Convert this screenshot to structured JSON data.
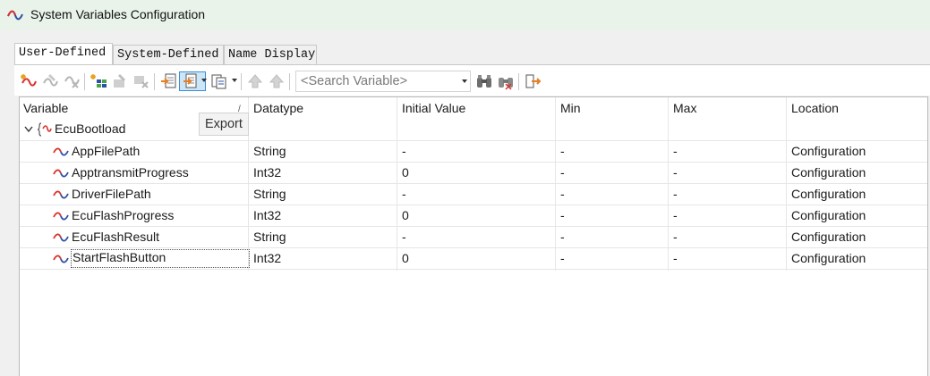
{
  "window": {
    "title": "System Variables Configuration",
    "icon": "system-variable-icon"
  },
  "tabs": [
    {
      "label": "User-Defined",
      "active": true
    },
    {
      "label": "System-Defined",
      "active": false
    },
    {
      "label": "Name Display",
      "active": false
    }
  ],
  "toolbar": {
    "buttons": [
      {
        "icon": "new-variable-icon",
        "enabled": true
      },
      {
        "icon": "edit-variable-icon",
        "enabled": false
      },
      {
        "icon": "delete-variable-icon",
        "enabled": false
      },
      {
        "icon": "new-struct-icon",
        "enabled": true
      },
      {
        "icon": "edit-struct-icon",
        "enabled": false
      },
      {
        "icon": "delete-struct-icon",
        "enabled": false
      },
      {
        "icon": "import-icon",
        "enabled": true
      },
      {
        "icon": "export-icon",
        "enabled": true,
        "pressed": true
      },
      {
        "icon": "copy-icon",
        "enabled": true
      },
      {
        "icon": "up-arrow-icon",
        "enabled": false
      },
      {
        "icon": "down-arrow-icon",
        "enabled": false
      },
      {
        "icon": "find-icon",
        "enabled": true
      },
      {
        "icon": "find-next-icon",
        "enabled": true
      },
      {
        "icon": "go-to-icon",
        "enabled": true
      }
    ],
    "search_placeholder": "<Search Variable>",
    "tooltip": "Export"
  },
  "table": {
    "columns": [
      "Variable",
      "Datatype",
      "Initial Value",
      "Min",
      "Max",
      "Location"
    ],
    "group": {
      "name": "EcuBootload",
      "expanded": true
    },
    "rows": [
      {
        "variable": "AppFilePath",
        "datatype": "String",
        "initial": "-",
        "min": "-",
        "max": "-",
        "location": "Configuration"
      },
      {
        "variable": "ApptransmitProgress",
        "datatype": "Int32",
        "initial": "0",
        "min": "-",
        "max": "-",
        "location": "Configuration"
      },
      {
        "variable": "DriverFilePath",
        "datatype": "String",
        "initial": "-",
        "min": "-",
        "max": "-",
        "location": "Configuration"
      },
      {
        "variable": "EcuFlashProgress",
        "datatype": "Int32",
        "initial": "0",
        "min": "-",
        "max": "-",
        "location": "Configuration"
      },
      {
        "variable": "EcuFlashResult",
        "datatype": "String",
        "initial": "-",
        "min": "-",
        "max": "-",
        "location": "Configuration"
      },
      {
        "variable": "StartFlashButton",
        "datatype": "Int32",
        "initial": "0",
        "min": "-",
        "max": "-",
        "location": "Configuration",
        "focused": true
      }
    ]
  },
  "colors": {
    "accent": "#3c8ed6",
    "variable_icon_red": "#d9322c",
    "variable_icon_blue": "#2c4fa8",
    "titlebar_bg": "#e9f3ea"
  }
}
